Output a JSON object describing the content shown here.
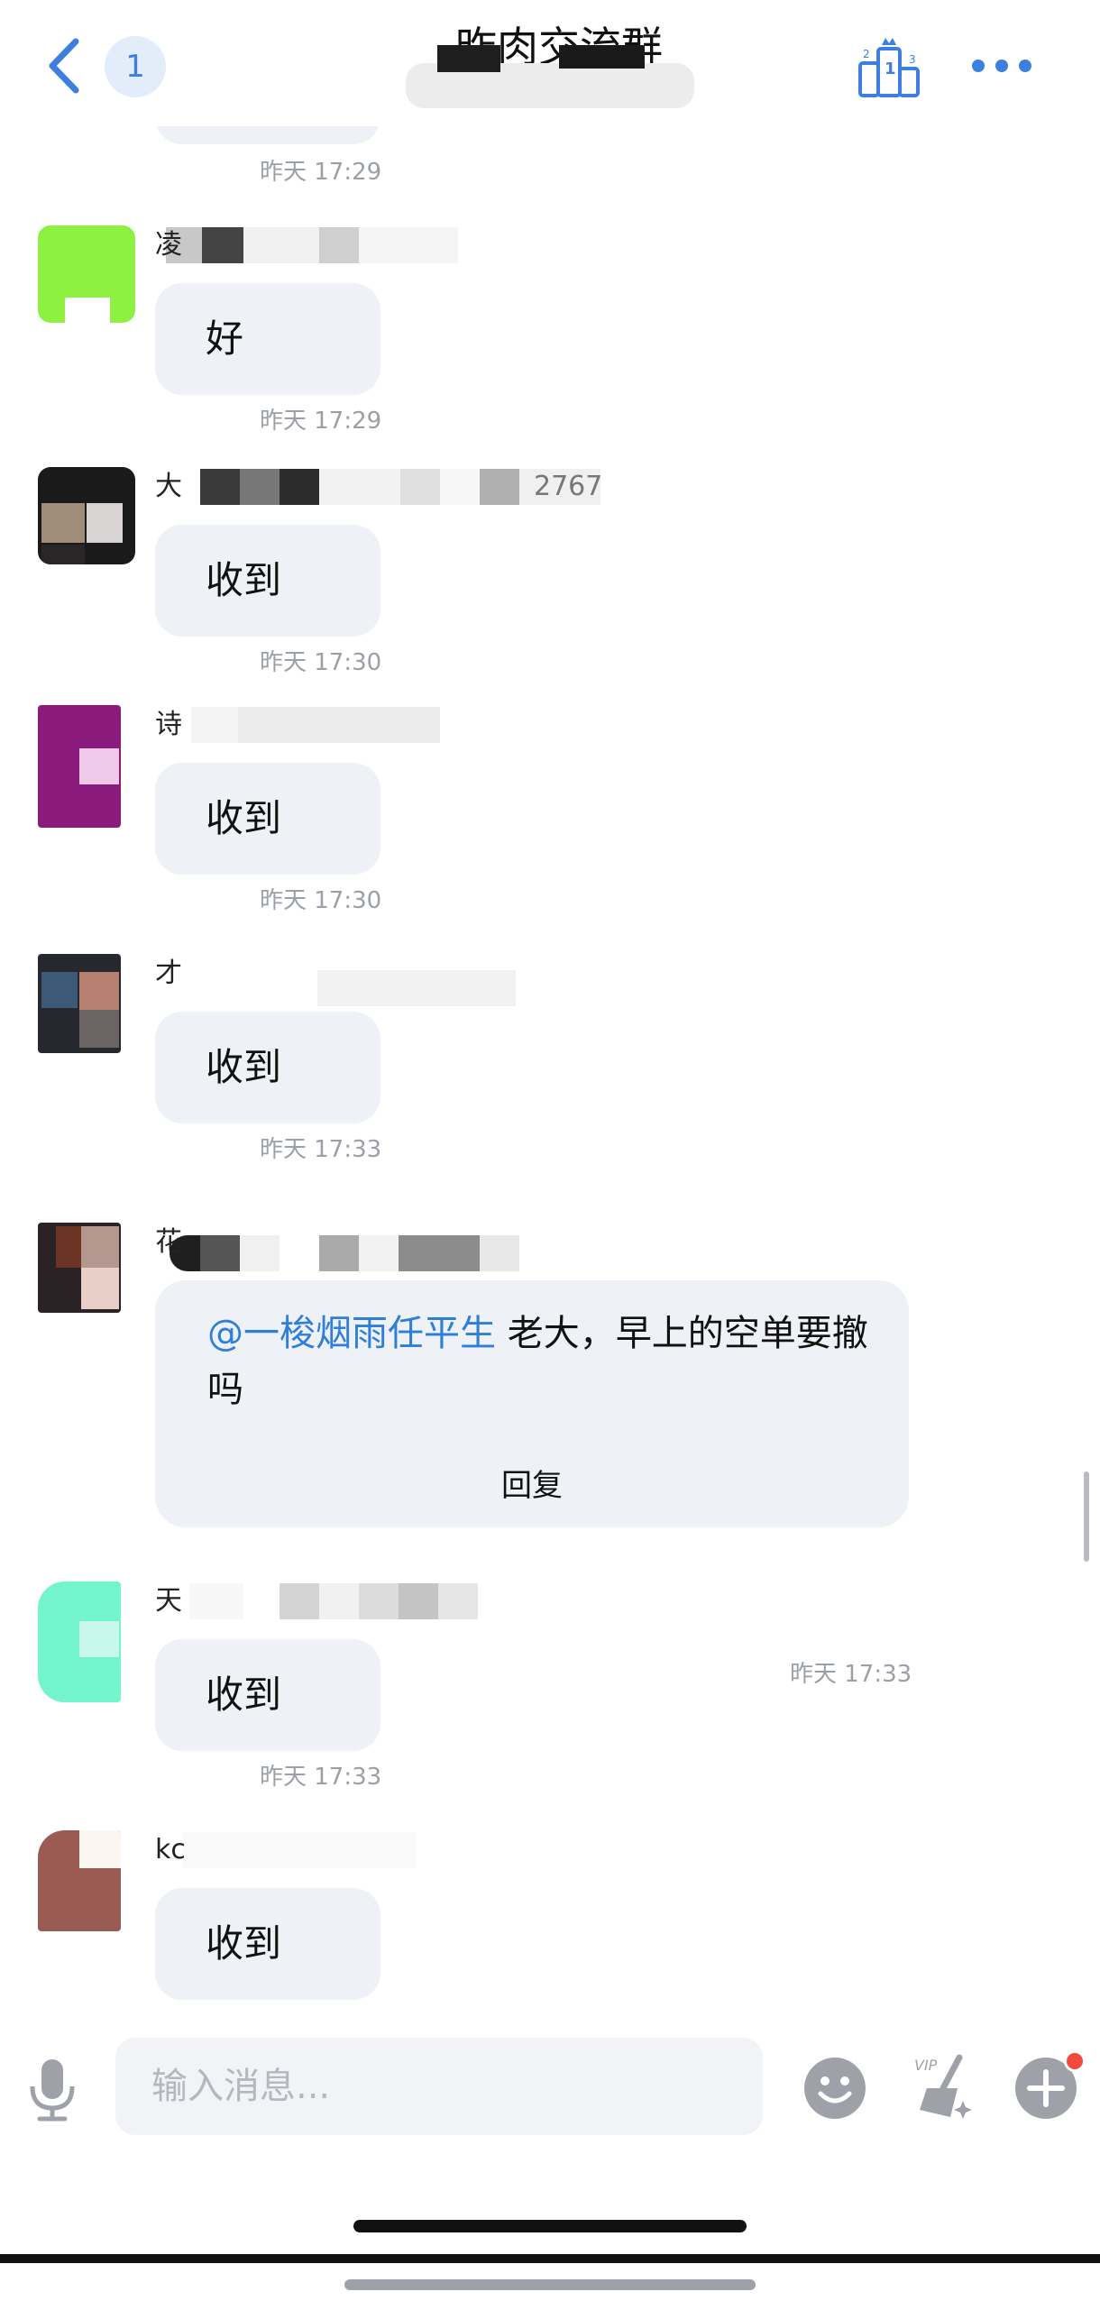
{
  "header": {
    "unread_count": "1",
    "title": "昨肉交流群"
  },
  "messages": [
    {
      "sender": "凌",
      "text": "好",
      "time": "昨天 17:29"
    },
    {
      "sender": "大",
      "sender_suffix": "2767",
      "text": "收到",
      "time": "昨天 17:30"
    },
    {
      "sender": "诗",
      "text": "收到",
      "time": "昨天 17:30"
    },
    {
      "sender": "才",
      "text": "收到",
      "time": "昨天 17:33"
    },
    {
      "sender": "花",
      "mention": "@一梭烟雨任平生",
      "text": " 老大，早上的空单要撤吗",
      "reply_label": "回复",
      "time": "昨天 17:33"
    },
    {
      "sender": "天",
      "text": "收到",
      "time": "昨天 17:33"
    },
    {
      "sender": "kc",
      "text": "收到"
    }
  ],
  "previous_time": "昨天 17:29",
  "input": {
    "placeholder": "输入消息..."
  },
  "colors": {
    "accent": "#3d7fe0",
    "bubble": "#eef1f5",
    "mention": "#2f7fd8",
    "notification_dot": "#f04a3e"
  },
  "icons": [
    "back-icon",
    "rank-podium-icon",
    "more-icon",
    "mic-icon",
    "emoji-icon",
    "vip-clean-icon",
    "plus-icon"
  ]
}
